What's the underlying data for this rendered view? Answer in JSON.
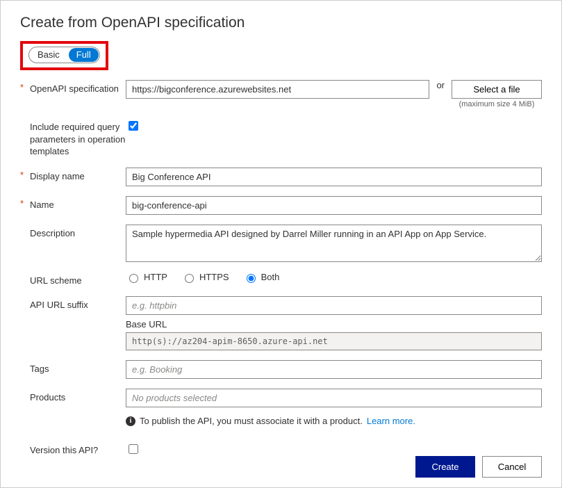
{
  "header": {
    "title": "Create from OpenAPI specification"
  },
  "toggle": {
    "basic": "Basic",
    "full": "Full"
  },
  "form": {
    "openapi": {
      "label": "OpenAPI specification",
      "value": "https://bigconference.azurewebsites.net",
      "or": "or",
      "select_file": "Select a file",
      "maxsize": "(maximum size 4 MiB)"
    },
    "include_params": {
      "label": "Include required query parameters in operation templates",
      "checked": true
    },
    "display_name": {
      "label": "Display name",
      "value": "Big Conference API"
    },
    "name": {
      "label": "Name",
      "value": "big-conference-api"
    },
    "description": {
      "label": "Description",
      "value": "Sample hypermedia API designed by Darrel Miller running in an API App on App Service."
    },
    "url_scheme": {
      "label": "URL scheme",
      "http": "HTTP",
      "https": "HTTPS",
      "both": "Both",
      "selected": "both"
    },
    "api_suffix": {
      "label": "API URL suffix",
      "placeholder": "e.g. httpbin"
    },
    "base_url": {
      "label": "Base URL",
      "value": "http(s)://az204-apim-8650.azure-api.net"
    },
    "tags": {
      "label": "Tags",
      "placeholder": "e.g. Booking"
    },
    "products": {
      "label": "Products",
      "placeholder": "No products selected",
      "info": "To publish the API, you must associate it with a product.",
      "learn": "Learn more."
    },
    "version": {
      "label": "Version this API?",
      "checked": false
    }
  },
  "footer": {
    "create": "Create",
    "cancel": "Cancel"
  }
}
